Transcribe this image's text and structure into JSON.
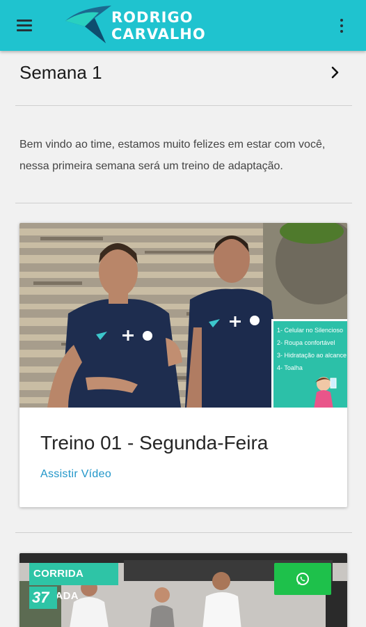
{
  "app": {
    "brand_line1": "RODRIGO",
    "brand_line2": "CARVALHO",
    "colors": {
      "appbar": "#1fc3cf",
      "accent_link": "#2196c9",
      "whatsapp": "#1ec14b",
      "teal_tag": "#2ec4a6"
    }
  },
  "week": {
    "title": "Semana 1",
    "description": "Bem vindo ao time, estamos muito felizes em estar com você, nessa primeira semana será um treino de adaptação."
  },
  "cards": [
    {
      "title": "Treino 01 - Segunda-Feira",
      "link": "Assistir Vídeo",
      "checklist": [
        "1- Celular no Silencioso",
        "2- Roupa confortável",
        "3- Hidratação ao alcance",
        "4- Toalha"
      ]
    },
    {
      "tag": "CORRIDA PARADA",
      "tag_number": "37"
    }
  ],
  "icons": {
    "menu": "menu-icon",
    "more": "more-vert-icon",
    "chevron": "chevron-right-icon",
    "whatsapp": "whatsapp-icon"
  }
}
